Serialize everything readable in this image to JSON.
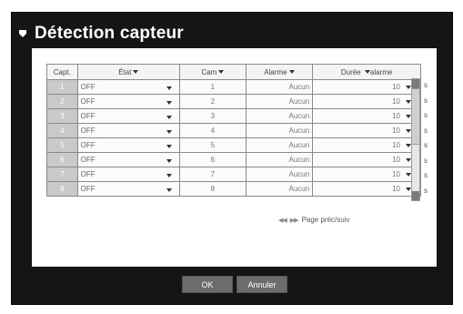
{
  "window": {
    "title": "Détection capteur",
    "title_icon": "shield-icon"
  },
  "table": {
    "headers": {
      "capt": "Capt.",
      "etat": "État",
      "cam": "Cam",
      "alarme": "Alarme",
      "duree": "Durée",
      "duree_suffix": "alarme"
    },
    "rows": [
      {
        "capt": "1",
        "etat": "OFF",
        "cam": "1",
        "alarme": "Aucun",
        "duree": "10"
      },
      {
        "capt": "2",
        "etat": "OFF",
        "cam": "2",
        "alarme": "Aucun",
        "duree": "10"
      },
      {
        "capt": "3",
        "etat": "OFF",
        "cam": "3",
        "alarme": "Aucun",
        "duree": "10"
      },
      {
        "capt": "4",
        "etat": "OFF",
        "cam": "4",
        "alarme": "Aucun",
        "duree": "10"
      },
      {
        "capt": "5",
        "etat": "OFF",
        "cam": "5",
        "alarme": "Aucun",
        "duree": "10"
      },
      {
        "capt": "6",
        "etat": "OFF",
        "cam": "6",
        "alarme": "Aucun",
        "duree": "10"
      },
      {
        "capt": "7",
        "etat": "OFF",
        "cam": "7",
        "alarme": "Aucun",
        "duree": "10"
      },
      {
        "capt": "8",
        "etat": "OFF",
        "cam": "8",
        "alarme": "Aucun",
        "duree": "10"
      }
    ],
    "unit": "s"
  },
  "pager": {
    "label": "Page préc/suiv"
  },
  "buttons": {
    "ok": "OK",
    "cancel": "Annuler"
  }
}
